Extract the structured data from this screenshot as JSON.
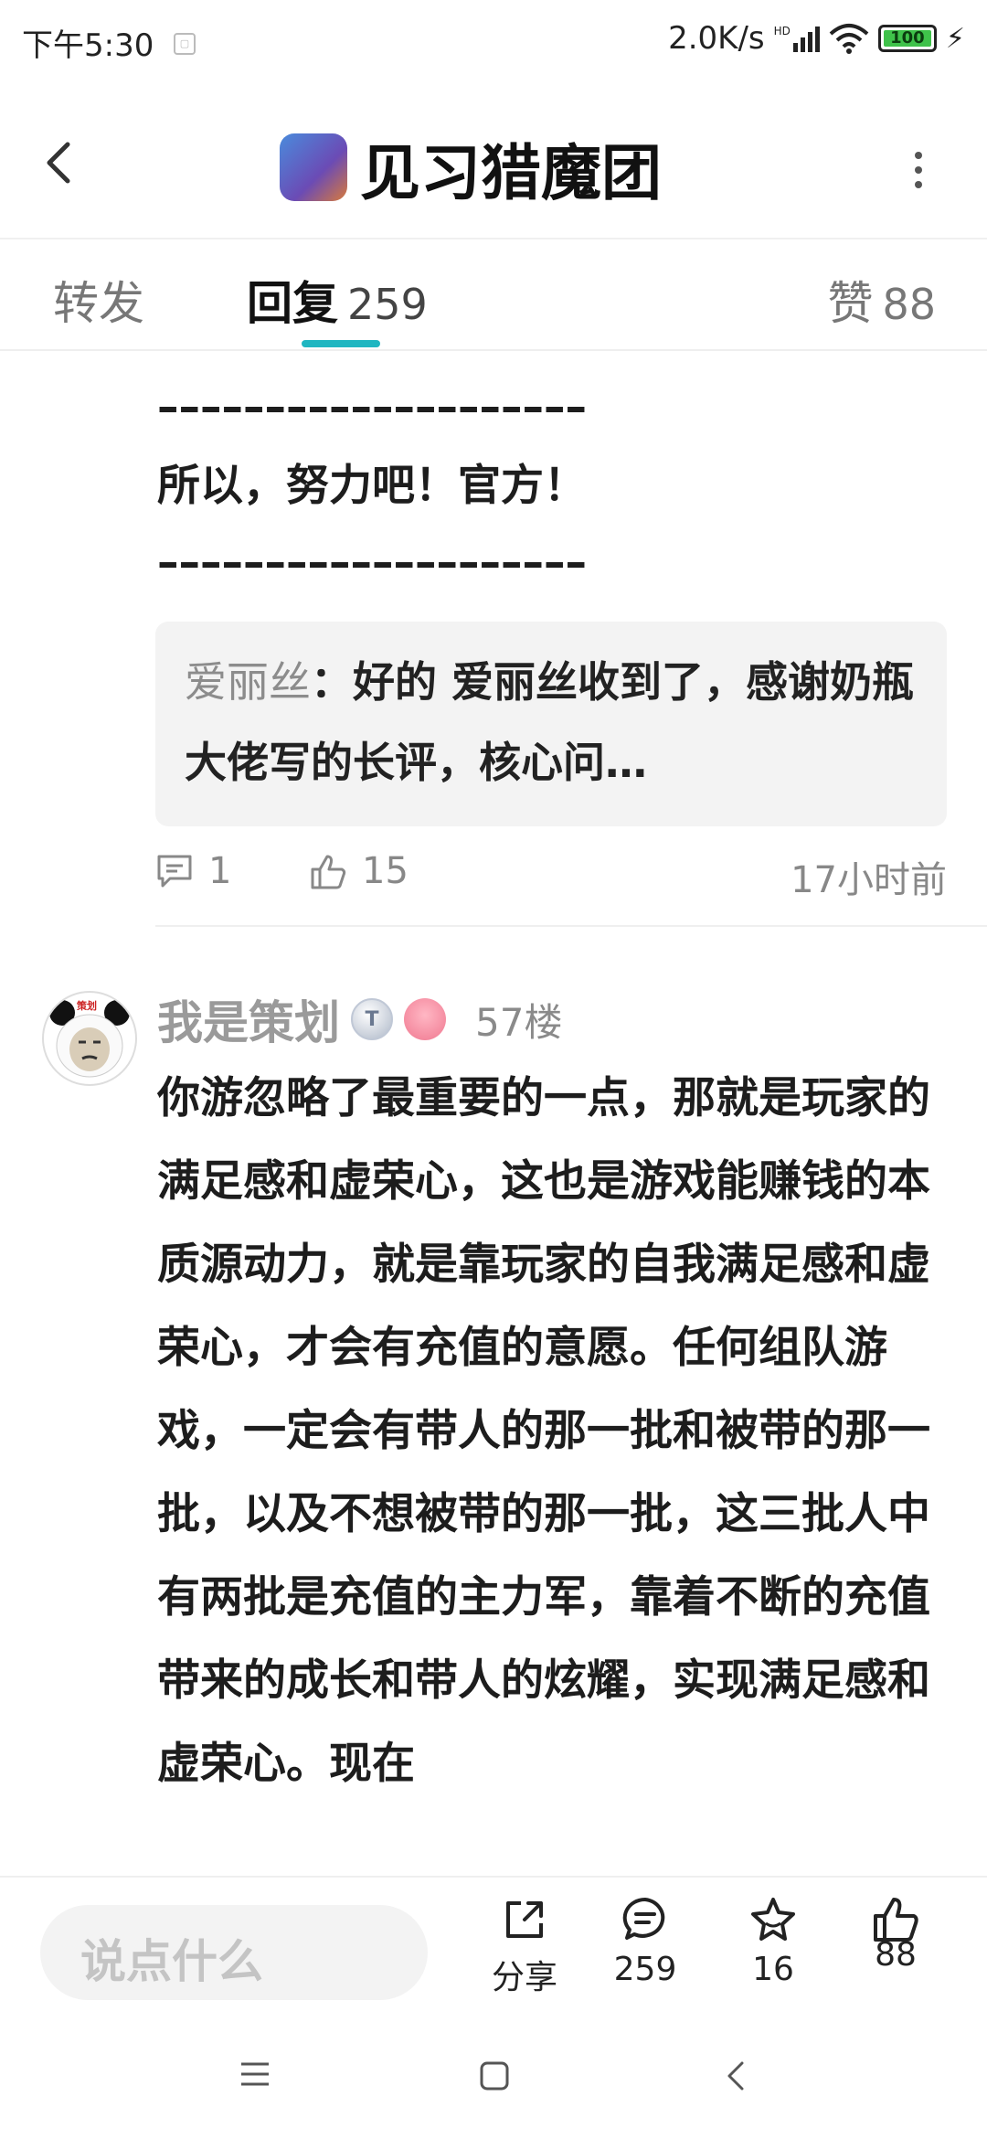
{
  "status_bar": {
    "time": "下午5:30",
    "network_speed": "2.0K/s",
    "signal_label": "HD",
    "battery": "100"
  },
  "header": {
    "title": "见习猎魔团"
  },
  "tabs": {
    "forward_label": "转发",
    "reply_label": "回复",
    "reply_count": "259",
    "like_label": "赞",
    "like_count": "88"
  },
  "previous_post": {
    "separator": "––––––––––––––––––––",
    "closing_line": "所以，努力吧！官方！",
    "quote_author": "爱丽丝",
    "quote_text": "：好的 爱丽丝收到了，感谢奶瓶大佬写的长评，核心问…",
    "comment_count": "1",
    "like_count": "15",
    "time": "17小时前"
  },
  "post": {
    "author": "我是策划",
    "level_badge": "T",
    "floor": "57楼",
    "avatar_caption": "策划",
    "content": "你游忽略了最重要的一点，那就是玩家的满足感和虚荣心，这也是游戏能赚钱的本质源动力，就是靠玩家的自我满足感和虚荣心，才会有充值的意愿。任何组队游戏，一定会有带人的那一批和被带的那一批，以及不想被带的那一批，这三批人中有两批是充值的主力军，靠着不断的充值带来的成长和带人的炫耀，实现满足感和虚荣心。现在"
  },
  "bottom_bar": {
    "input_placeholder": "说点什么",
    "share_label": "分享",
    "comment_count": "259",
    "favorite_count": "16",
    "like_count": "88"
  },
  "colors": {
    "accent": "#1fb6c1",
    "muted_text": "#8c8c8c",
    "quote_bg": "#f3f3f3"
  }
}
